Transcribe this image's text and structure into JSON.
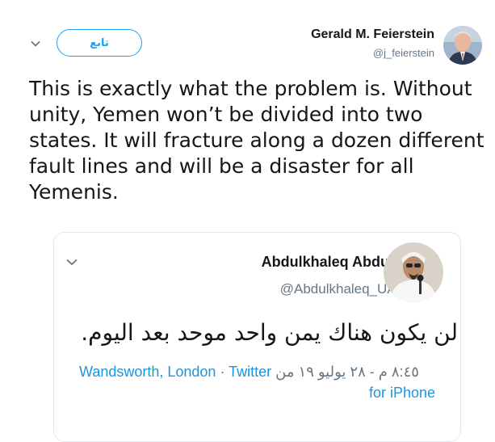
{
  "tweet": {
    "follow_label": "تابع",
    "author_name": "Gerald M. Feierstein",
    "author_handle": "@j_feierstein",
    "text": "This is exactly what the problem is. Without unity, Yemen won’t be divided into two states. It will fracture along a dozen different fault lines and will be a disaster for all Yemenis."
  },
  "quoted": {
    "author_name": "Abdulkhaleq Abdulla",
    "author_handle": "@Abdulkhaleq_UAE",
    "text": "لن يكون هناك يمن واحد موحد بعد اليوم.",
    "location": "Wandsworth, London",
    "separator": "·",
    "source_prefix": "Twitter",
    "timestamp": "٨:٤٥ م - ٢٨ يوليو ١٩ من",
    "source_suffix": "for iPhone"
  },
  "colors": {
    "accent": "#1da1f2",
    "link": "#1b95e0",
    "muted": "#657786",
    "text": "#14171a",
    "border": "#e1e8ed"
  },
  "icons": {
    "caret": "chevron-down-icon",
    "avatar": "avatar",
    "quoted_avatar": "avatar"
  }
}
